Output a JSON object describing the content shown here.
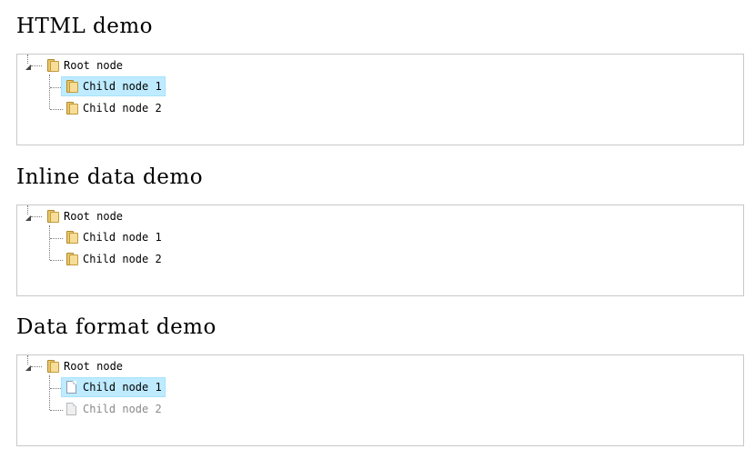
{
  "demos": [
    {
      "title": "HTML demo",
      "root": {
        "label": "Root node",
        "icon": "folder-icon"
      },
      "children": [
        {
          "label": "Child node 1",
          "icon": "folder-icon",
          "selected": true,
          "disabled": false
        },
        {
          "label": "Child node 2",
          "icon": "folder-icon",
          "selected": false,
          "disabled": false
        }
      ]
    },
    {
      "title": "Inline data demo",
      "root": {
        "label": "Root node",
        "icon": "folder-icon"
      },
      "children": [
        {
          "label": "Child node 1",
          "icon": "folder-icon",
          "selected": false,
          "disabled": false
        },
        {
          "label": "Child node 2",
          "icon": "folder-icon",
          "selected": false,
          "disabled": false
        }
      ]
    },
    {
      "title": "Data format demo",
      "root": {
        "label": "Root node",
        "icon": "folder-icon"
      },
      "children": [
        {
          "label": "Child node 1",
          "icon": "file-icon",
          "selected": true,
          "disabled": false
        },
        {
          "label": "Child node 2",
          "icon": "file-icon",
          "selected": false,
          "disabled": true
        }
      ]
    }
  ],
  "colors": {
    "selected_background": "#beebff",
    "border": "#c8c8c8",
    "disabled_text": "#8a8a8a"
  }
}
